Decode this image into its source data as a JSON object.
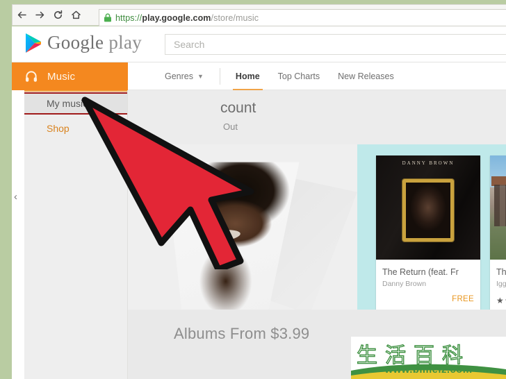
{
  "browser": {
    "back_icon": "back-arrow-icon",
    "forward_icon": "forward-arrow-icon",
    "reload_icon": "reload-icon",
    "home_icon": "home-icon",
    "lock_icon": "ssl-lock-icon",
    "url_scheme": "https://",
    "url_host": "play.google.com",
    "url_path": "/store/music",
    "url_full": "https://play.google.com/store/music"
  },
  "header": {
    "brand_google": "Google",
    "brand_play": "play",
    "logo_icon": "google-play-triangle-icon",
    "search_placeholder": "Search",
    "search_value": ""
  },
  "music_bar": {
    "label": "Music",
    "icon": "headphones-icon"
  },
  "nav": {
    "genres": "Genres",
    "genres_caret": "chevron-down-icon",
    "home": "Home",
    "top_charts": "Top Charts",
    "new_releases": "New Releases"
  },
  "sidebar": {
    "my_music": "My music",
    "shop": "Shop",
    "collapse_icon": "chevron-left-icon"
  },
  "content": {
    "account_title": "count",
    "account_sub": "Out",
    "promo_text": "Albums From $3.99"
  },
  "albums": [
    {
      "title": "The Return (feat. Fr",
      "artist": "Danny Brown",
      "price": "FREE",
      "art_title": "DANNY\nBROWN",
      "stars": ""
    },
    {
      "title": "The",
      "artist": "Iggy A",
      "price": "",
      "art_title": "",
      "stars": "★★"
    }
  ],
  "cursor": {
    "icon": "large-red-arrow-cursor",
    "fill": "#e32636",
    "stroke": "#111111"
  },
  "watermark": {
    "chars": "生活百科",
    "url": "www.bimeiz.com"
  },
  "colors": {
    "frame_green": "#b9cca2",
    "accent_orange": "#f4881f",
    "tab_underline": "#f0a448",
    "shop_orange": "#d9831f",
    "highlight_red": "#a01b1b",
    "shelf_teal": "#bfe9ea",
    "price_orange": "#e8961e",
    "watermark_green": "#3f9142"
  }
}
